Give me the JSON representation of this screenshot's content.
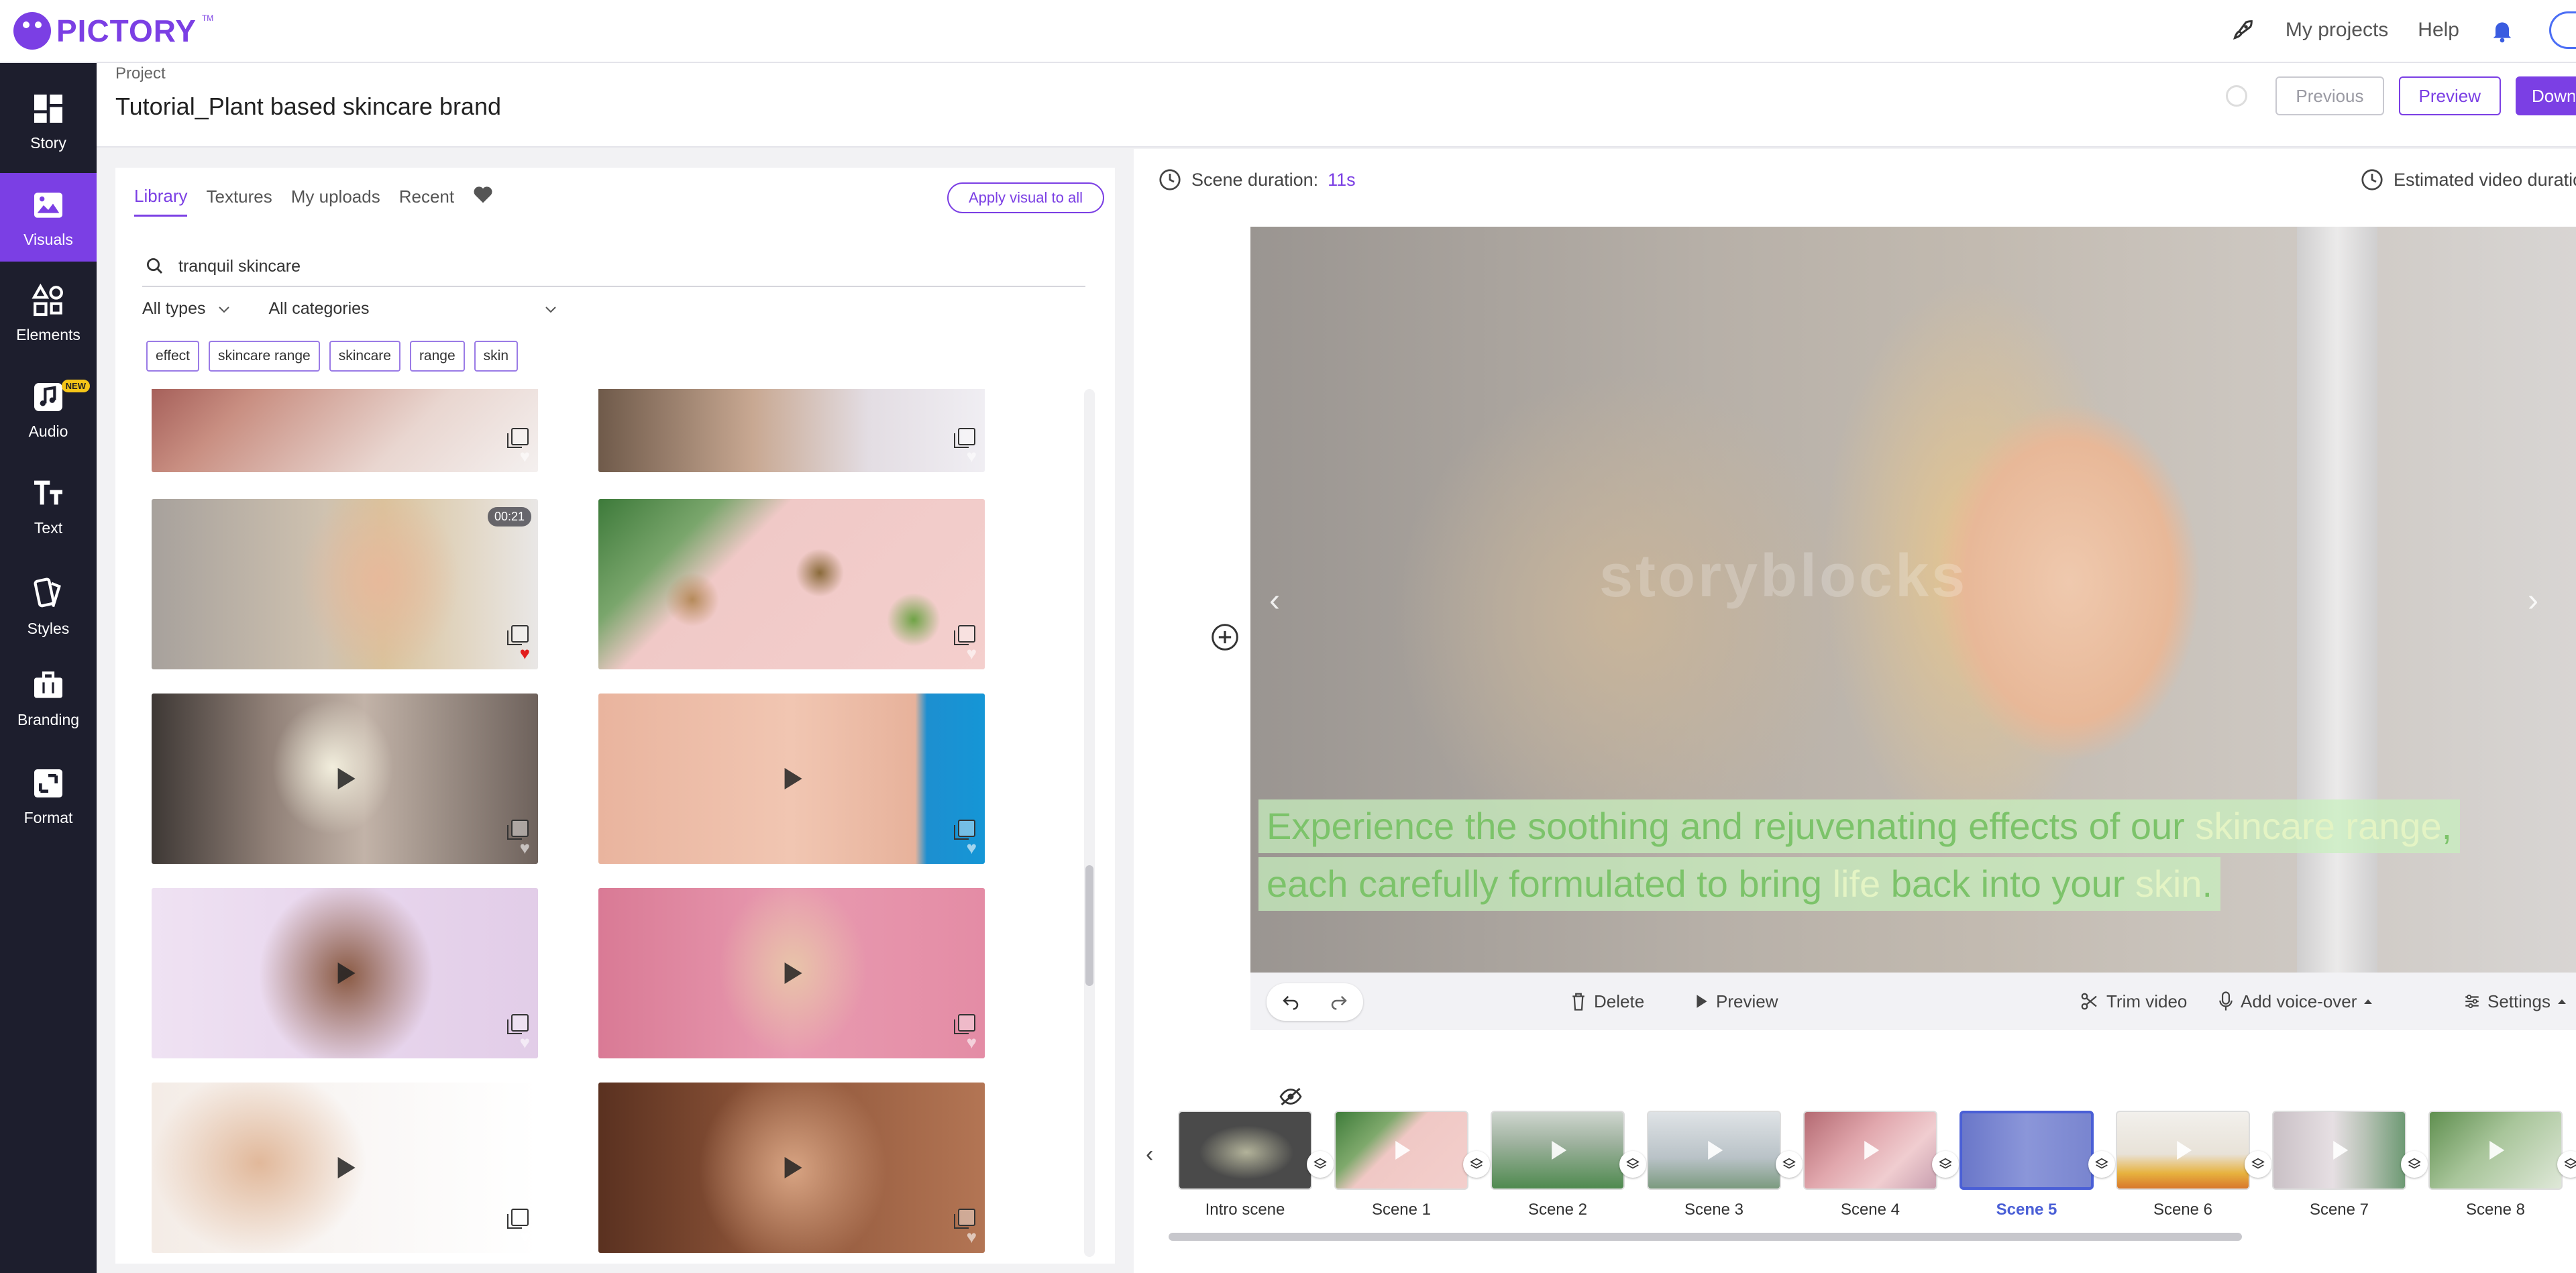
{
  "header": {
    "logo_text": "PICTORY",
    "logo_tm": "TM",
    "my_projects": "My projects",
    "help": "Help"
  },
  "sidebar": {
    "items": [
      {
        "label": "Story",
        "icon": "story-icon"
      },
      {
        "label": "Visuals",
        "icon": "image-icon",
        "active": true
      },
      {
        "label": "Elements",
        "icon": "shapes-icon"
      },
      {
        "label": "Audio",
        "icon": "music-icon",
        "badge": "NEW"
      },
      {
        "label": "Text",
        "icon": "text-icon"
      },
      {
        "label": "Styles",
        "icon": "styles-icon"
      },
      {
        "label": "Branding",
        "icon": "briefcase-icon"
      },
      {
        "label": "Format",
        "icon": "format-icon"
      }
    ]
  },
  "project": {
    "label": "Project",
    "title": "Tutorial_Plant based skincare brand",
    "previous": "Previous",
    "preview": "Preview",
    "download": "Download"
  },
  "library": {
    "tabs": [
      "Library",
      "Textures",
      "My uploads",
      "Recent"
    ],
    "active_tab": "Library",
    "apply_all": "Apply visual to all",
    "search_value": "tranquil skincare",
    "type_filter": "All types",
    "category_filter": "All categories",
    "chips": [
      "effect",
      "skincare range",
      "skincare",
      "range",
      "skin"
    ],
    "cards": [
      {
        "duration": "",
        "favorite": false
      },
      {
        "duration": "",
        "favorite": false
      },
      {
        "duration": "00:21",
        "favorite": true
      },
      {
        "duration": "",
        "favorite": false
      },
      {
        "duration": "",
        "favorite": false
      },
      {
        "duration": "",
        "favorite": false
      },
      {
        "duration": "",
        "favorite": false
      },
      {
        "duration": "",
        "favorite": false
      },
      {
        "duration": "",
        "favorite": false
      },
      {
        "duration": "",
        "favorite": false
      }
    ]
  },
  "editor": {
    "scene_duration_label": "Scene duration:",
    "scene_duration_value": "11s",
    "estimated_label": "Estimated video duration",
    "watermark": "storyblocks",
    "caption": {
      "line1_a": "Experience the soothing and rejuvenating effects of our ",
      "line1_hl": "skincare range",
      "line1_b": ",",
      "line2_a": "each carefully formulated to bring ",
      "line2_hl1": "life",
      "line2_b": " back into your ",
      "line2_hl2": "skin",
      "line2_c": "."
    },
    "controls": {
      "delete": "Delete",
      "preview": "Preview",
      "trim": "Trim video",
      "voiceover": "Add voice-over",
      "settings": "Settings"
    }
  },
  "timeline": {
    "scenes": [
      "Intro scene",
      "Scene 1",
      "Scene 2",
      "Scene 3",
      "Scene 4",
      "Scene 5",
      "Scene 6",
      "Scene 7",
      "Scene 8"
    ],
    "active_scene": "Scene 5"
  },
  "colors": {
    "brand": "#7b3fe4",
    "sidebar_bg": "#1d1e2d",
    "active_scene": "#4a5fd6",
    "caption_text": "#7cc36a"
  }
}
